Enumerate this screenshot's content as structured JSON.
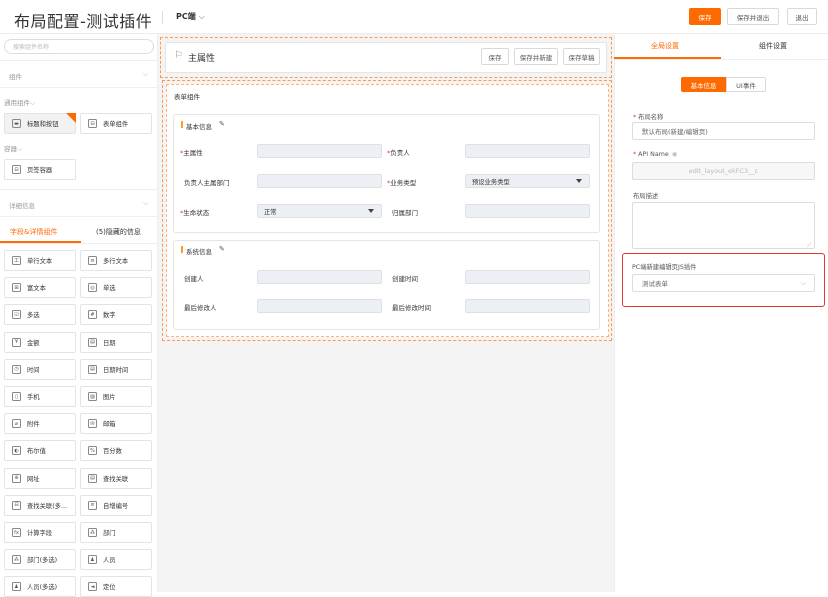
{
  "header": {
    "title": "布局配置-测试插件",
    "device": "PC端",
    "save_label": "保存",
    "save_exit_label": "保存并退出",
    "exit_label": "退出"
  },
  "left": {
    "search_placeholder": "搜索组件名称",
    "section_component": "组件",
    "group_common": "通用组件",
    "common_items": [
      "标题和按钮",
      "表单组件"
    ],
    "group_container": "容器",
    "container_items": [
      "页签容器"
    ],
    "section_detail": "详细信息",
    "tabs": [
      "字段&详情组件",
      "(5)隐藏的信息"
    ],
    "fields": [
      {
        "label": "单行文本",
        "icon": "text-icon",
        "glyph": "工"
      },
      {
        "label": "多行文本",
        "icon": "multiline-icon",
        "glyph": "≡"
      },
      {
        "label": "富文本",
        "icon": "richtext-icon",
        "glyph": "⊞"
      },
      {
        "label": "单选",
        "icon": "radio-icon",
        "glyph": "◎"
      },
      {
        "label": "多选",
        "icon": "checkbox-icon",
        "glyph": "☑"
      },
      {
        "label": "数字",
        "icon": "number-icon",
        "glyph": "#"
      },
      {
        "label": "金额",
        "icon": "currency-icon",
        "glyph": "¥"
      },
      {
        "label": "日期",
        "icon": "calendar-icon",
        "glyph": "▤"
      },
      {
        "label": "时间",
        "icon": "clock-icon",
        "glyph": "◷"
      },
      {
        "label": "日期时间",
        "icon": "datetime-icon",
        "glyph": "▤"
      },
      {
        "label": "手机",
        "icon": "phone-icon",
        "glyph": "▯"
      },
      {
        "label": "图片",
        "icon": "image-icon",
        "glyph": "▨"
      },
      {
        "label": "附件",
        "icon": "attachment-icon",
        "glyph": "⌀"
      },
      {
        "label": "邮箱",
        "icon": "mail-icon",
        "glyph": "✉"
      },
      {
        "label": "布尔值",
        "icon": "boolean-icon",
        "glyph": "◐"
      },
      {
        "label": "百分数",
        "icon": "percent-icon",
        "glyph": "%"
      },
      {
        "label": "网址",
        "icon": "globe-icon",
        "glyph": "⊕"
      },
      {
        "label": "查找关联",
        "icon": "lookup-icon",
        "glyph": "▤"
      },
      {
        "label": "查找关联(多...",
        "icon": "lookup-multi-icon",
        "glyph": "⊟"
      },
      {
        "label": "自增编号",
        "icon": "autonumber-icon",
        "glyph": "≡"
      },
      {
        "label": "计算字段",
        "icon": "formula-icon",
        "glyph": "fx"
      },
      {
        "label": "部门",
        "icon": "department-icon",
        "glyph": "⁂"
      },
      {
        "label": "部门(多选)",
        "icon": "department-multi-icon",
        "glyph": "⁂"
      },
      {
        "label": "人员",
        "icon": "user-icon",
        "glyph": "♟"
      },
      {
        "label": "人员(多选)",
        "icon": "user-multi-icon",
        "glyph": "♟"
      },
      {
        "label": "定位",
        "icon": "location-icon",
        "glyph": "◄"
      }
    ]
  },
  "canvas": {
    "record_title": "主属性",
    "record_buttons": [
      "保存",
      "保存并新建",
      "保存草稿"
    ],
    "form_label": "表单组件",
    "basic_section": "基本信息",
    "basic_fields": [
      {
        "label": "主属性",
        "required": true
      },
      {
        "label": "负责人",
        "required": true
      },
      {
        "label": "负责人主属部门",
        "required": false
      },
      {
        "label": "业务类型",
        "required": true,
        "value": "预设业务类型"
      },
      {
        "label": "生命状态",
        "required": true,
        "value": "正常"
      },
      {
        "label": "归属部门",
        "required": false
      }
    ],
    "system_section": "系统信息",
    "system_fields": [
      "创建人",
      "创建时间",
      "最后修改人",
      "最后修改时间"
    ]
  },
  "right": {
    "tabs": [
      "全局设置",
      "组件设置"
    ],
    "subtabs": [
      "基本信息",
      "UI事件"
    ],
    "layout_name_label": "布局名称",
    "layout_name_value": "默认布局(新建/编辑页)",
    "api_name_label": "API Name",
    "api_name_value": "edit_layout_ekFC3__c",
    "desc_label": "布局描述",
    "plugin_label": "PC端新建编辑页JS插件",
    "plugin_value": "测试表单",
    "accent": "#ff6a00",
    "highlight": "#e03a2f"
  }
}
